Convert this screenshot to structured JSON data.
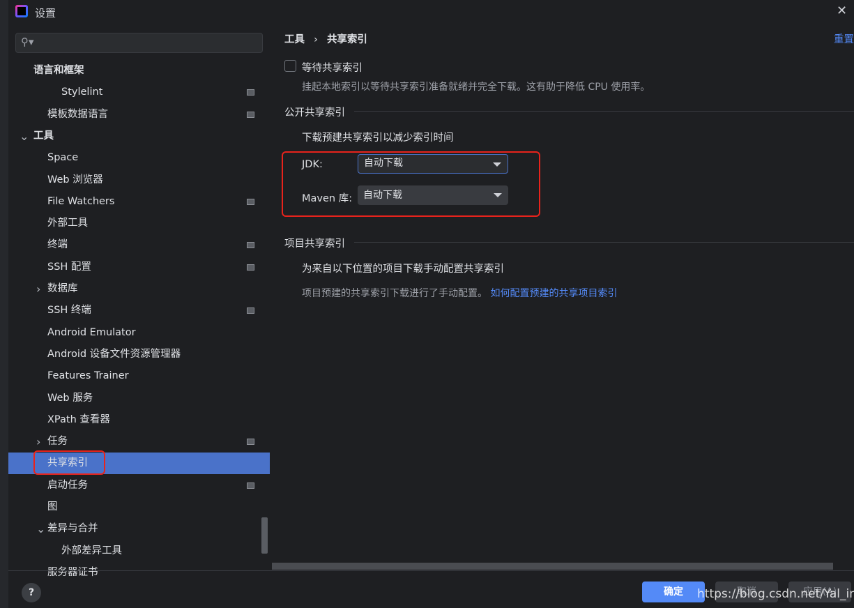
{
  "window": {
    "title": "设置",
    "close_icon": "close-icon"
  },
  "search": {
    "placeholder": ""
  },
  "sidebar": {
    "items": [
      {
        "label": "语言和框架",
        "indent": 0,
        "bold": true
      },
      {
        "label": "Stylelint",
        "indent": 2,
        "icon": true
      },
      {
        "label": "模板数据语言",
        "indent": 1,
        "icon": true
      },
      {
        "label": "工具",
        "indent": 0,
        "chevron": "down",
        "bold": true
      },
      {
        "label": "Space",
        "indent": 1
      },
      {
        "label": "Web 浏览器",
        "indent": 1
      },
      {
        "label": "File Watchers",
        "indent": 1,
        "icon": true
      },
      {
        "label": "外部工具",
        "indent": 1
      },
      {
        "label": "终端",
        "indent": 1,
        "icon": true
      },
      {
        "label": "SSH 配置",
        "indent": 1,
        "icon": true
      },
      {
        "label": "数据库",
        "indent": 1,
        "chevron": "right"
      },
      {
        "label": "SSH 终端",
        "indent": 1,
        "icon": true
      },
      {
        "label": "Android Emulator",
        "indent": 1
      },
      {
        "label": "Android 设备文件资源管理器",
        "indent": 1
      },
      {
        "label": "Features Trainer",
        "indent": 1
      },
      {
        "label": "Web 服务",
        "indent": 1
      },
      {
        "label": "XPath 查看器",
        "indent": 1
      },
      {
        "label": "任务",
        "indent": 1,
        "chevron": "right",
        "icon": true
      },
      {
        "label": "共享索引",
        "indent": 1,
        "selected": true
      },
      {
        "label": "启动任务",
        "indent": 1,
        "icon": true
      },
      {
        "label": "图",
        "indent": 1
      },
      {
        "label": "差异与合并",
        "indent": 1,
        "chevron": "down"
      },
      {
        "label": "外部差异工具",
        "indent": 2
      },
      {
        "label": "服务器证书",
        "indent": 1
      }
    ]
  },
  "breadcrumb": {
    "parent": "工具",
    "separator": "›",
    "current": "共享索引"
  },
  "reset_label": "重置",
  "wait": {
    "label": "等待共享索引",
    "checked": false,
    "desc": "挂起本地索引以等待共享索引准备就绪并完全下载。这有助于降低 CPU 使用率。"
  },
  "public": {
    "title": "公开共享索引",
    "desc": "下载预建共享索引以减少索引时间",
    "jdk_label": "JDK:",
    "jdk_value": "自动下载",
    "maven_label": "Maven 库:",
    "maven_value": "自动下载"
  },
  "project": {
    "title": "项目共享索引",
    "desc": "为来自以下位置的项目下载手动配置共享索引",
    "note": "项目预建的共享索引下载进行了手动配置。",
    "link": "如何配置预建的共享项目索引"
  },
  "footer": {
    "help": "?",
    "ok": "确定",
    "cancel": "取消",
    "apply": "应用(A)"
  },
  "watermark": "https://blog.csdn.net/Yal_insist",
  "colors": {
    "accent": "#4a72c9",
    "link": "#548af7",
    "highlight": "#e8231c"
  }
}
